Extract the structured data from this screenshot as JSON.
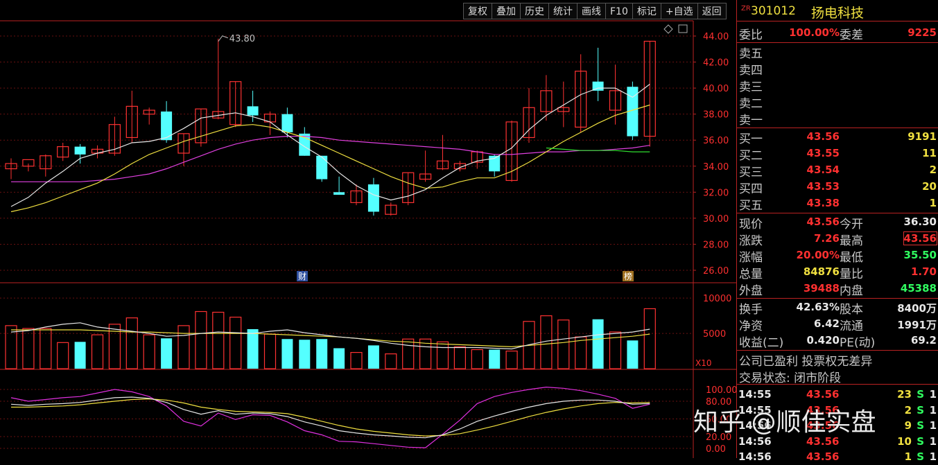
{
  "toolbar": [
    "复权",
    "叠加",
    "历史",
    "统计",
    "画线",
    "F10",
    "标记",
    "+自选",
    "返回"
  ],
  "stock": {
    "zr": "ZR",
    "code": "301012",
    "name": "扬电科技"
  },
  "weibi": {
    "label1": "委比",
    "val1": "100.00%",
    "label2": "委差",
    "val2": "9225"
  },
  "sells": [
    {
      "label": "卖五"
    },
    {
      "label": "卖四"
    },
    {
      "label": "卖三"
    },
    {
      "label": "卖二"
    },
    {
      "label": "卖一"
    }
  ],
  "buys": [
    {
      "label": "买一",
      "price": "43.56",
      "vol": "9191"
    },
    {
      "label": "买二",
      "price": "43.55",
      "vol": "11"
    },
    {
      "label": "买三",
      "price": "43.54",
      "vol": "2"
    },
    {
      "label": "买四",
      "price": "43.53",
      "vol": "20"
    },
    {
      "label": "买五",
      "price": "43.38",
      "vol": "1"
    }
  ],
  "quote": [
    {
      "l1": "现价",
      "v1": "43.56",
      "c1": "red",
      "l2": "今开",
      "v2": "36.30",
      "c2": "white"
    },
    {
      "l1": "涨跌",
      "v1": "7.26",
      "c1": "red",
      "l2": "最高",
      "v2": "43.56",
      "c2": "red"
    },
    {
      "l1": "涨幅",
      "v1": "20.00%",
      "c1": "red",
      "l2": "最低",
      "v2": "35.50",
      "c2": "green"
    },
    {
      "l1": "总量",
      "v1": "84876",
      "c1": "yellow",
      "l2": "量比",
      "v2": "1.70",
      "c2": "red"
    },
    {
      "l1": "外盘",
      "v1": "39488",
      "c1": "red",
      "l2": "内盘",
      "v2": "45388",
      "c2": "green"
    }
  ],
  "finance": [
    {
      "l1": "换手",
      "v1": "42.63%",
      "l2": "股本",
      "v2": "8400万"
    },
    {
      "l1": "净资",
      "v1": "6.42",
      "l2": "流通",
      "v2": "1991万"
    },
    {
      "l1": "收益(二)",
      "v1": "0.420",
      "l2": "PE(动)",
      "v2": "69.2"
    }
  ],
  "notes": [
    "公司已盈利 投票权无差异",
    "交易状态: 闭市阶段"
  ],
  "ticks": [
    {
      "time": "14:55",
      "price": "43.56",
      "vol": "23",
      "side": "S",
      "n": "1"
    },
    {
      "time": "14:55",
      "price": "43.56",
      "vol": "2",
      "side": "S",
      "n": "1"
    },
    {
      "time": "14:56",
      "price": "43.56",
      "vol": "9",
      "side": "S",
      "n": "1"
    },
    {
      "time": "14:56",
      "price": "43.56",
      "vol": "10",
      "side": "S",
      "n": "1"
    },
    {
      "time": "14:56",
      "price": "43.56",
      "vol": "1",
      "side": "S",
      "n": "1"
    }
  ],
  "watermark": "知乎 @顺佳实盘",
  "chart_data": {
    "type": "candlestick",
    "price_axis": [
      "44.00",
      "42.00",
      "40.00",
      "38.00",
      "36.00",
      "34.00",
      "32.00",
      "30.00",
      "28.00",
      "26.00"
    ],
    "price_range": [
      25,
      45
    ],
    "max_label": "43.80",
    "markers": [
      "财",
      "榜"
    ],
    "candles": [
      [
        33.8,
        34.6,
        33.0,
        34.2
      ],
      [
        34.0,
        34.2,
        33.6,
        34.5
      ],
      [
        33.8,
        34.9,
        33.2,
        34.8
      ],
      [
        34.7,
        35.8,
        34.4,
        35.5
      ],
      [
        35.5,
        35.7,
        34.2,
        34.9
      ],
      [
        35.0,
        35.6,
        34.6,
        35.3
      ],
      [
        35.0,
        37.8,
        34.8,
        37.2
      ],
      [
        36.2,
        39.8,
        35.8,
        38.6
      ],
      [
        38.0,
        38.5,
        37.2,
        38.3
      ],
      [
        38.2,
        39.0,
        35.8,
        36.0
      ],
      [
        35.0,
        36.5,
        34.0,
        36.5
      ],
      [
        35.8,
        38.4,
        35.5,
        38.4
      ],
      [
        37.7,
        43.8,
        37.6,
        38.2
      ],
      [
        37.2,
        40.5,
        37.0,
        40.5
      ],
      [
        38.6,
        39.8,
        37.4,
        37.9
      ],
      [
        37.4,
        38.2,
        36.4,
        38.0
      ],
      [
        38.0,
        38.5,
        36.2,
        36.6
      ],
      [
        36.5,
        37.0,
        34.8,
        34.8
      ],
      [
        34.8,
        34.8,
        32.8,
        33.0
      ],
      [
        32.0,
        33.2,
        31.8,
        31.8
      ],
      [
        31.2,
        32.6,
        31.0,
        32.1
      ],
      [
        32.6,
        33.1,
        30.2,
        30.5
      ],
      [
        30.3,
        31.2,
        30.2,
        31.0
      ],
      [
        31.2,
        33.5,
        31.0,
        33.5
      ],
      [
        33.0,
        35.2,
        32.8,
        33.4
      ],
      [
        33.8,
        36.4,
        33.7,
        34.4
      ],
      [
        33.8,
        34.4,
        33.6,
        34.2
      ],
      [
        34.3,
        35.2,
        33.8,
        35.1
      ],
      [
        34.8,
        34.9,
        33.2,
        33.6
      ],
      [
        32.9,
        37.5,
        32.8,
        37.4
      ],
      [
        36.2,
        40.0,
        35.8,
        38.5
      ],
      [
        38.2,
        41.0,
        37.5,
        39.8
      ],
      [
        38.2,
        40.5,
        37.0,
        38.5
      ],
      [
        37.0,
        42.6,
        36.6,
        41.3
      ],
      [
        40.5,
        43.1,
        39.0,
        39.8
      ],
      [
        38.3,
        41.8,
        37.2,
        39.8
      ],
      [
        40.1,
        40.5,
        36.0,
        36.3
      ],
      [
        36.3,
        43.6,
        35.5,
        43.6
      ]
    ],
    "ma5": [
      30.9,
      31.6,
      32.7,
      33.6,
      34.6,
      35.0,
      35.3,
      35.8,
      35.9,
      36.2,
      36.9,
      37.7,
      37.9,
      38.1,
      37.8,
      37.4,
      36.4,
      35.5,
      34.7,
      33.5,
      32.5,
      31.8,
      31.4,
      31.7,
      32.2,
      33.1,
      33.9,
      34.4,
      34.6,
      35.4,
      36.8,
      37.9,
      38.7,
      39.5,
      40.0,
      40.0,
      39.3,
      40.3
    ],
    "ma10": [
      30.5,
      30.8,
      31.2,
      31.7,
      32.2,
      32.7,
      33.4,
      34.2,
      34.9,
      35.4,
      35.9,
      36.3,
      36.7,
      37.1,
      37.2,
      37.0,
      36.6,
      36.2,
      35.6,
      35.0,
      34.4,
      33.8,
      33.2,
      32.7,
      32.3,
      32.4,
      32.8,
      33.1,
      33.1,
      33.6,
      34.3,
      35.1,
      35.9,
      36.6,
      37.3,
      37.9,
      38.3,
      38.7
    ],
    "ma20": [
      32.8,
      32.8,
      32.8,
      32.8,
      32.8,
      32.9,
      33.0,
      33.2,
      33.4,
      33.8,
      34.3,
      34.8,
      35.3,
      35.7,
      36.0,
      36.2,
      36.3,
      36.3,
      36.2,
      36.0,
      35.9,
      35.8,
      35.7,
      35.6,
      35.5,
      35.4,
      35.3,
      35.1,
      34.9,
      34.9,
      35.0,
      35.1,
      35.1,
      35.2,
      35.2,
      35.3,
      35.4,
      35.6
    ],
    "ma60": [
      35.4,
      35.3,
      35.2,
      35.2,
      35.2,
      35.1,
      35.1
    ],
    "volume_axis": [
      "10000",
      "5000"
    ],
    "volume_unit": "X10",
    "volume": [
      6100,
      5700,
      5700,
      3700,
      3800,
      4800,
      6300,
      7200,
      4800,
      4300,
      6100,
      8100,
      8000,
      7300,
      5600,
      4900,
      4200,
      4100,
      4200,
      2900,
      2300,
      3300,
      2100,
      4200,
      4200,
      3800,
      3100,
      2700,
      2700,
      2500,
      6700,
      7500,
      6900,
      4500,
      7000,
      5200,
      4000,
      8500
    ],
    "volume_ma5": [
      5200,
      5400,
      5900,
      6300,
      6500,
      5900,
      5600,
      5300,
      5000,
      4600,
      4700,
      5000,
      5200,
      5100,
      5000,
      5300,
      5500,
      5100,
      4800,
      4500,
      4300,
      4000,
      3600,
      3300,
      3100,
      3000,
      3000,
      3000,
      2900,
      2800,
      3400,
      3900,
      4200,
      4500,
      4800,
      5000,
      5200,
      5600
    ],
    "volume_ma10": [
      5500,
      5500,
      5500,
      5500,
      5500,
      5400,
      5300,
      5200,
      5200,
      5100,
      5000,
      5000,
      5000,
      5000,
      5000,
      4900,
      4800,
      4700,
      4600,
      4500,
      4300,
      4100,
      3900,
      3800,
      3600,
      3500,
      3400,
      3300,
      3200,
      3100,
      3300,
      3500,
      3700,
      4000,
      4200,
      4400,
      4600,
      4900
    ],
    "osc_axis": [
      "100.00",
      "80.00",
      "50.00",
      "20.00",
      "0.00"
    ],
    "osc_k": [
      75,
      73,
      75,
      76,
      78,
      82,
      86,
      87,
      85,
      78,
      66,
      58,
      64,
      58,
      60,
      59,
      54,
      45,
      38,
      30,
      26,
      23,
      21,
      19,
      18,
      23,
      33,
      46,
      55,
      63,
      70,
      76,
      80,
      82,
      82,
      80,
      75,
      76
    ],
    "osc_d": [
      70,
      70,
      71,
      72,
      74,
      77,
      80,
      83,
      84,
      82,
      77,
      70,
      66,
      63,
      62,
      61,
      59,
      53,
      46,
      39,
      33,
      29,
      26,
      23,
      21,
      22,
      25,
      31,
      38,
      46,
      54,
      61,
      67,
      72,
      76,
      78,
      77,
      78
    ],
    "osc_j": [
      86,
      80,
      83,
      86,
      88,
      94,
      100,
      96,
      88,
      72,
      46,
      38,
      60,
      49,
      57,
      56,
      45,
      30,
      23,
      12,
      11,
      8,
      5,
      2,
      1,
      24,
      48,
      76,
      88,
      95,
      100,
      104,
      102,
      98,
      92,
      85,
      68,
      75
    ]
  }
}
